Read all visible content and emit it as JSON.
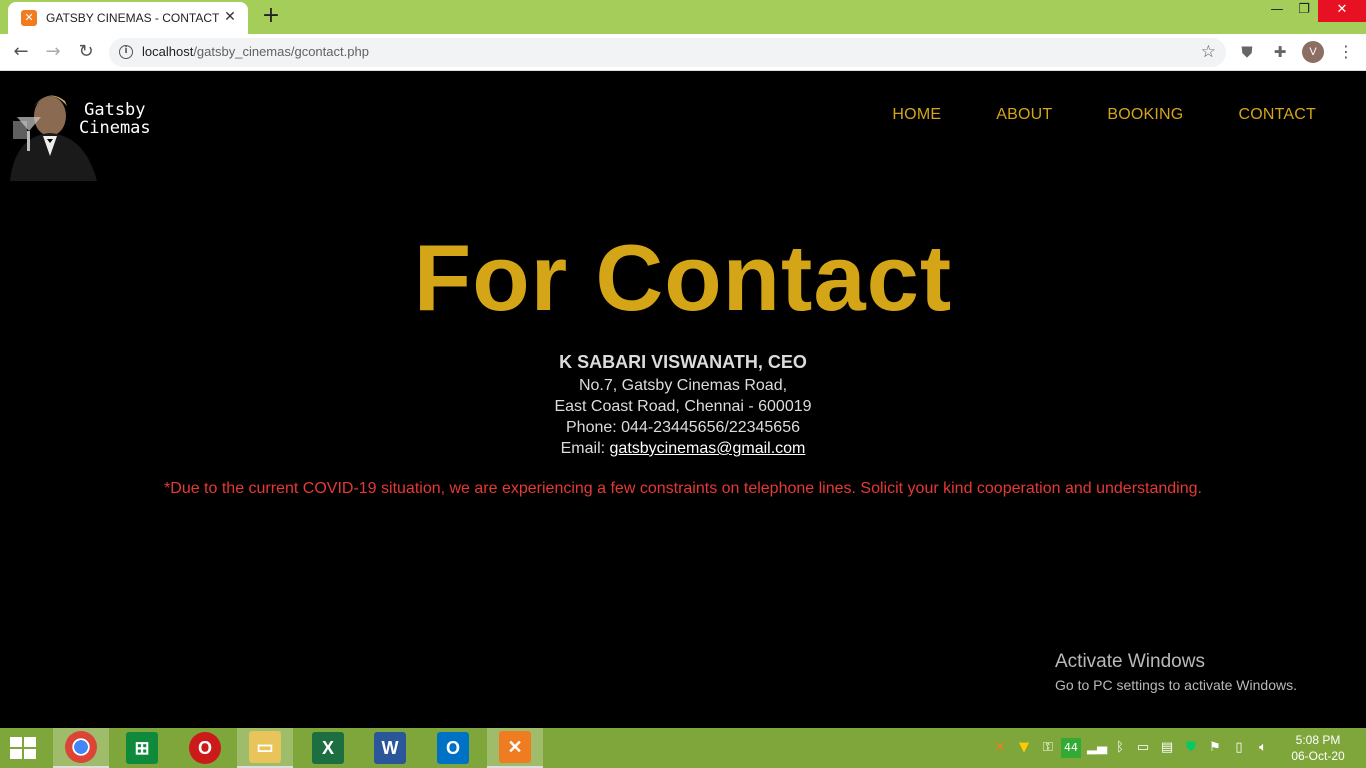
{
  "browser": {
    "tab_title": "GATSBY CINEMAS - CONTACT",
    "url_host": "localhost",
    "url_path": "/gatsby_cinemas/gcontact.php",
    "profile_initial": "V"
  },
  "site": {
    "logo_line1": "Gatsby",
    "logo_line2": "Cinemas",
    "nav": [
      "HOME",
      "ABOUT",
      "BOOKING",
      "CONTACT"
    ]
  },
  "contact": {
    "heading": "For Contact",
    "name": "K SABARI VISWANATH, CEO",
    "address1": "No.7, Gatsby Cinemas Road,",
    "address2": "East Coast Road, Chennai - 600019",
    "phone": "Phone: 044-23445656/22345656",
    "email_label": "Email: ",
    "email": "gatsbycinemas@gmail.com",
    "notice": "*Due to the current COVID-19 situation, we are experiencing a few constraints on telephone lines. Solicit your kind cooperation and understanding."
  },
  "watermark": {
    "title": "Activate Windows",
    "subtitle": "Go to PC settings to activate Windows."
  },
  "taskbar": {
    "tray_badge": "44",
    "time": "5:08 PM",
    "date": "06-Oct-20"
  },
  "colors": {
    "accent_gold": "#d4a517",
    "notice_red": "#e53935",
    "chrome_green": "#a5cd59",
    "taskbar_green": "#7fa63a"
  }
}
